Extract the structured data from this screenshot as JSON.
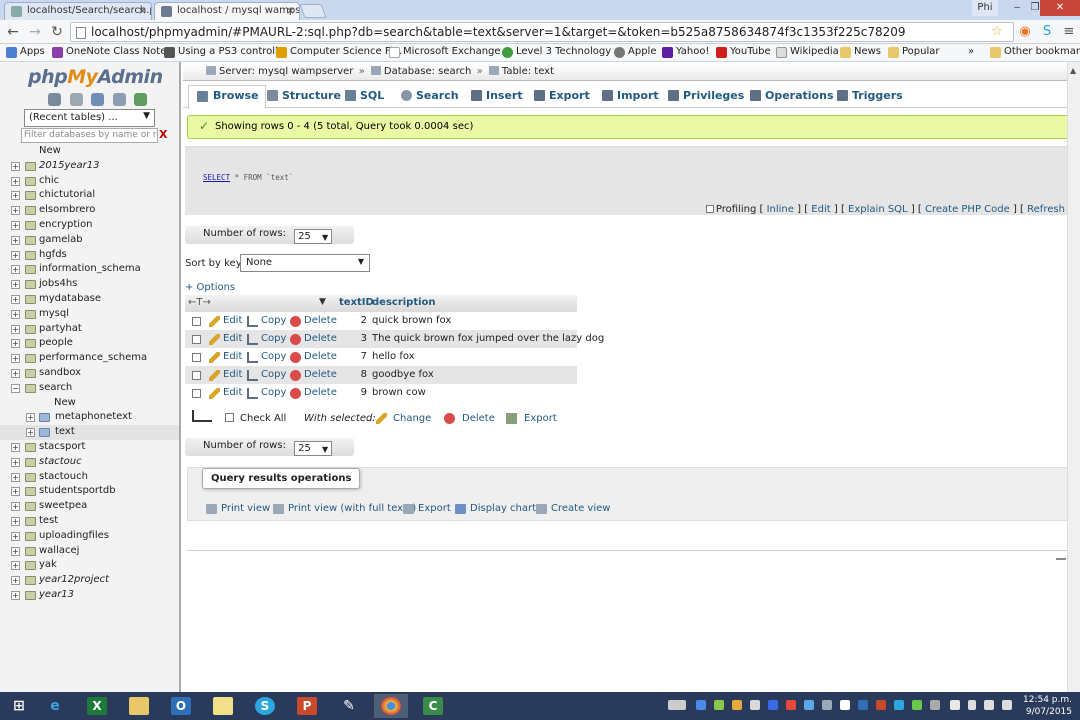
{
  "browser": {
    "tabs": [
      {
        "title": "localhost/Search/search.p"
      },
      {
        "title": "localhost / mysql wampse"
      }
    ],
    "url": "localhost/phpmyadmin/#PMAURL-2:sql.php?db=search&table=text&server=1&target=&token=b525a8758634874f3c1353f225c78209",
    "user_badge": "Phi",
    "bookmarks": [
      {
        "label": "Apps",
        "color": "#4a7fd1"
      },
      {
        "label": "OneNote Class Note...",
        "color": "#8b3fa8"
      },
      {
        "label": "Using a PS3 controll...",
        "color": "#555555"
      },
      {
        "label": "Computer Science Fi...",
        "color": "#e0a000"
      },
      {
        "label": "Microsoft Exchange ...",
        "color": "#ffffff"
      },
      {
        "label": "Level 3 Technology ...",
        "color": "#3f9d3f"
      },
      {
        "label": "Apple",
        "color": "#777777"
      },
      {
        "label": "Yahoo!",
        "color": "#5a1fa3"
      },
      {
        "label": "YouTube",
        "color": "#d0201e"
      },
      {
        "label": "Wikipedia",
        "color": "#dddddd"
      },
      {
        "label": "News",
        "color": "#e8c86a"
      },
      {
        "label": "Popular",
        "color": "#e8c86a"
      }
    ],
    "bookmarks_more": "»",
    "other_bookmarks": "Other bookmarks"
  },
  "sidebar": {
    "logo_php": "php",
    "logo_my": "My",
    "logo_admin": "Admin",
    "recent_tables": "(Recent tables) ...",
    "filter_placeholder": "Filter databases by name or re",
    "filter_clear": "X",
    "databases": [
      {
        "name": "New",
        "type": "new"
      },
      {
        "name": "2015year13",
        "italic": true
      },
      {
        "name": "chic"
      },
      {
        "name": "chictutorial"
      },
      {
        "name": "elsombrero"
      },
      {
        "name": "encryption"
      },
      {
        "name": "gamelab"
      },
      {
        "name": "hgfds"
      },
      {
        "name": "information_schema"
      },
      {
        "name": "jobs4hs"
      },
      {
        "name": "mydatabase"
      },
      {
        "name": "mysql"
      },
      {
        "name": "partyhat"
      },
      {
        "name": "people"
      },
      {
        "name": "performance_schema"
      },
      {
        "name": "sandbox"
      },
      {
        "name": "search",
        "expanded": true
      },
      {
        "name": "New",
        "type": "subnew"
      },
      {
        "name": "metaphonetext",
        "type": "table"
      },
      {
        "name": "text",
        "type": "table",
        "selected": true
      },
      {
        "name": "stacsport"
      },
      {
        "name": "stactouc",
        "italic": true
      },
      {
        "name": "stactouch"
      },
      {
        "name": "studentsportdb"
      },
      {
        "name": "sweetpea"
      },
      {
        "name": "test"
      },
      {
        "name": "uploadingfiles"
      },
      {
        "name": "wallacej"
      },
      {
        "name": "yak"
      },
      {
        "name": "year12project",
        "italic": true
      },
      {
        "name": "year13",
        "italic": true
      }
    ]
  },
  "breadcrumb": {
    "server": "Server: mysql wampserver",
    "database": "Database: search",
    "table": "Table: text",
    "sep": "»"
  },
  "tabs": [
    {
      "label": "Browse",
      "active": true,
      "color": "#6a7f98"
    },
    {
      "label": "Structure",
      "color": "#7a8b9e"
    },
    {
      "label": "SQL",
      "color": "#6a7f98"
    },
    {
      "label": "Search",
      "color": "#8896a8"
    },
    {
      "label": "Insert",
      "color": "#5e6f86"
    },
    {
      "label": "Export",
      "color": "#5e6f86"
    },
    {
      "label": "Import",
      "color": "#5e6f86"
    },
    {
      "label": "Privileges",
      "color": "#5e6f86"
    },
    {
      "label": "Operations",
      "color": "#5e6f86"
    },
    {
      "label": "Triggers",
      "color": "#5e6f86"
    }
  ],
  "message": {
    "text": "Showing rows 0 - 4 (5 total, Query took 0.0004 sec)",
    "icon": "✓"
  },
  "query": {
    "keyword": "SELECT",
    "rest": " * FROM `text`"
  },
  "query_links": {
    "profiling": "Profiling",
    "inline": "Inline",
    "edit": "Edit",
    "explain": "Explain SQL",
    "create_php": "Create PHP Code",
    "refresh": "Refresh",
    "lb": "[",
    "rb": "]"
  },
  "controls": {
    "number_of_rows_label": "Number of rows:",
    "number_of_rows_value": "25",
    "sort_by_key_label": "Sort by key:",
    "sort_by_key_value": "None",
    "options_link": "+ Options"
  },
  "table": {
    "header_arrows": "←T→",
    "sort_triangle": "▼",
    "columns": [
      "textID",
      "description"
    ],
    "edit_label": "Edit",
    "copy_label": "Copy",
    "delete_label": "Delete",
    "rows": [
      {
        "textID": "2",
        "description": "quick brown fox"
      },
      {
        "textID": "3",
        "description": "The quick brown fox jumped over the lazy dog"
      },
      {
        "textID": "7",
        "description": "hello fox"
      },
      {
        "textID": "8",
        "description": "goodbye fox"
      },
      {
        "textID": "9",
        "description": "brown cow"
      }
    ]
  },
  "bulk": {
    "check_all": "Check All",
    "with_selected": "With selected:",
    "change": "Change",
    "delete": "Delete",
    "export": "Export"
  },
  "query_results_operations": {
    "legend": "Query results operations",
    "items": [
      {
        "label": "Print view"
      },
      {
        "label": "Print view (with full texts)"
      },
      {
        "label": "Export"
      },
      {
        "label": "Display chart"
      },
      {
        "label": "Create view"
      }
    ]
  },
  "taskbar": {
    "time": "12:54 p.m.",
    "date": "9/07/2015"
  }
}
